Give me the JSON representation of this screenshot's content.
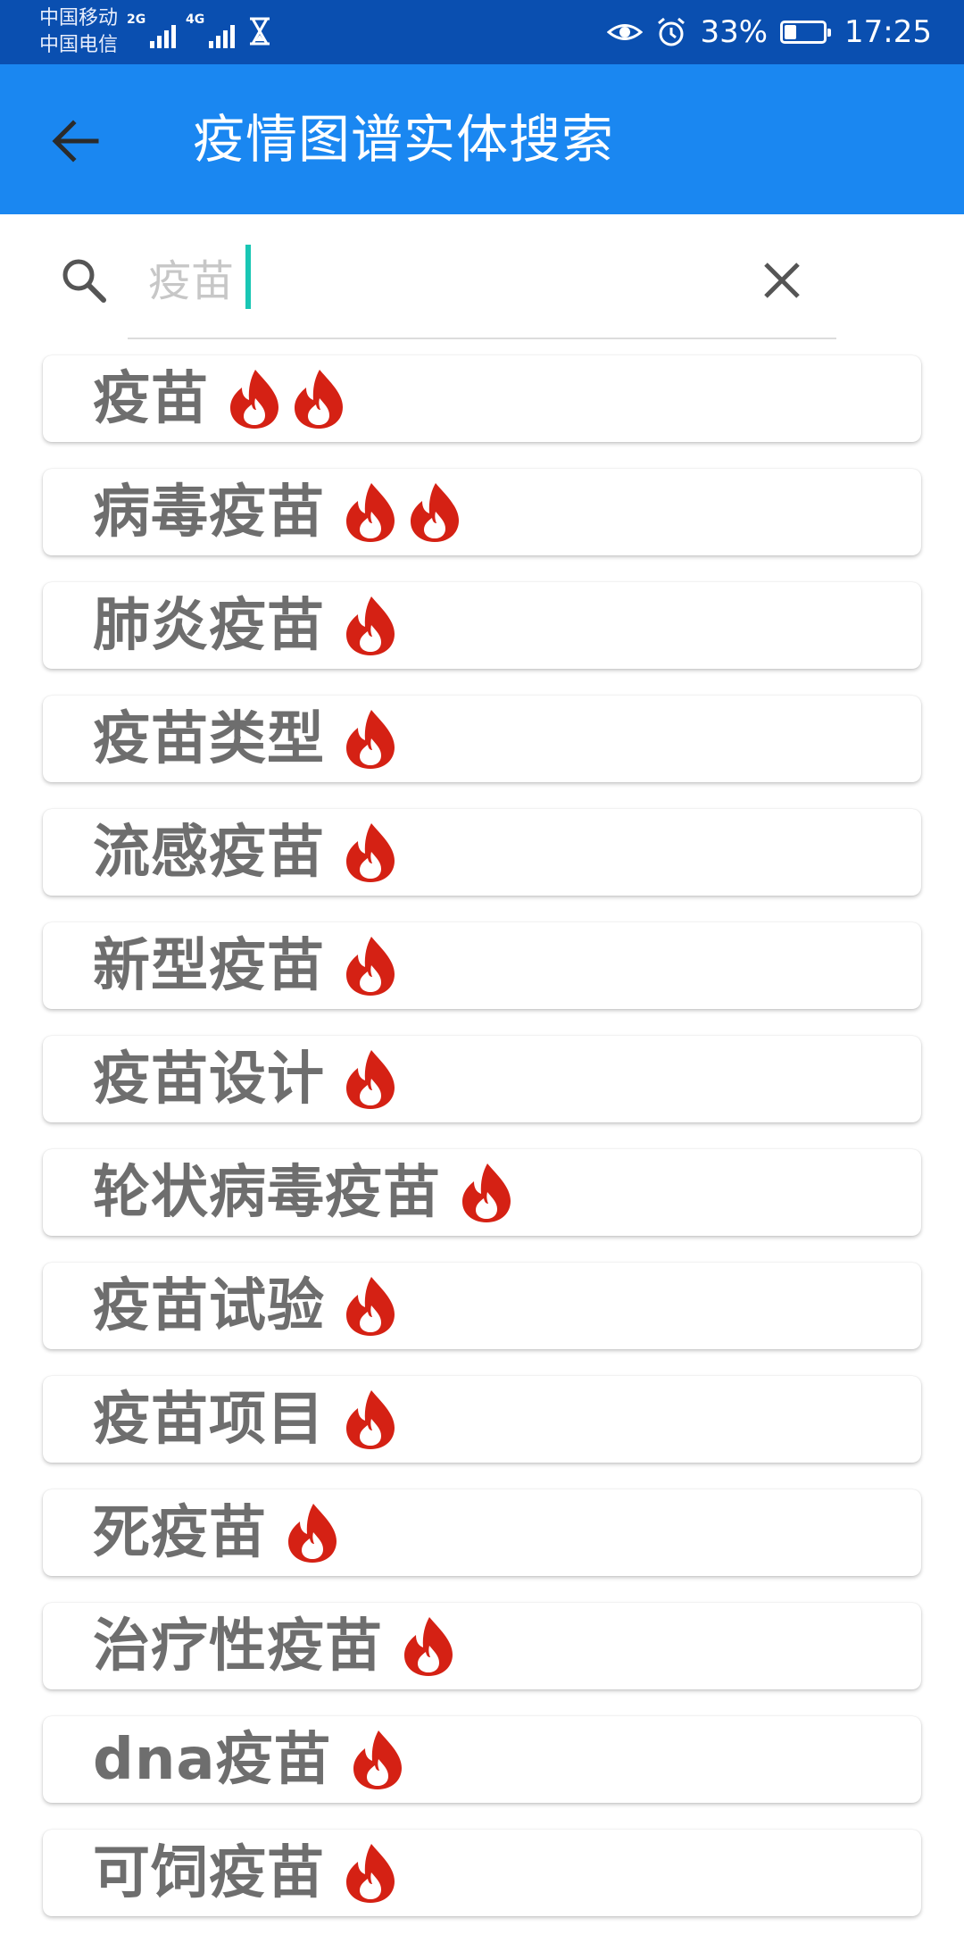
{
  "status_bar": {
    "carrier1": "中国移动",
    "carrier2": "中国电信",
    "net1": "2G",
    "net2": "4G",
    "battery": "33%",
    "time": "17:25"
  },
  "app_bar": {
    "title": "疫情图谱实体搜索"
  },
  "search": {
    "placeholder": "疫苗",
    "value": ""
  },
  "colors": {
    "app_bar": "#1a87f1",
    "status_bar": "#0a4fb0",
    "flame": "#d52114",
    "text": "#6e6e6e",
    "caret": "#19c6b4"
  },
  "results": [
    {
      "label": "疫苗",
      "hot": 2
    },
    {
      "label": "病毒疫苗",
      "hot": 2
    },
    {
      "label": "肺炎疫苗",
      "hot": 1
    },
    {
      "label": "疫苗类型",
      "hot": 1
    },
    {
      "label": "流感疫苗",
      "hot": 1
    },
    {
      "label": "新型疫苗",
      "hot": 1
    },
    {
      "label": "疫苗设计",
      "hot": 1
    },
    {
      "label": "轮状病毒疫苗",
      "hot": 1
    },
    {
      "label": "疫苗试验",
      "hot": 1
    },
    {
      "label": "疫苗项目",
      "hot": 1
    },
    {
      "label": "死疫苗",
      "hot": 1
    },
    {
      "label": "治疗性疫苗",
      "hot": 1
    },
    {
      "label": "dna疫苗",
      "hot": 1
    },
    {
      "label": "可饲疫苗",
      "hot": 1
    }
  ]
}
